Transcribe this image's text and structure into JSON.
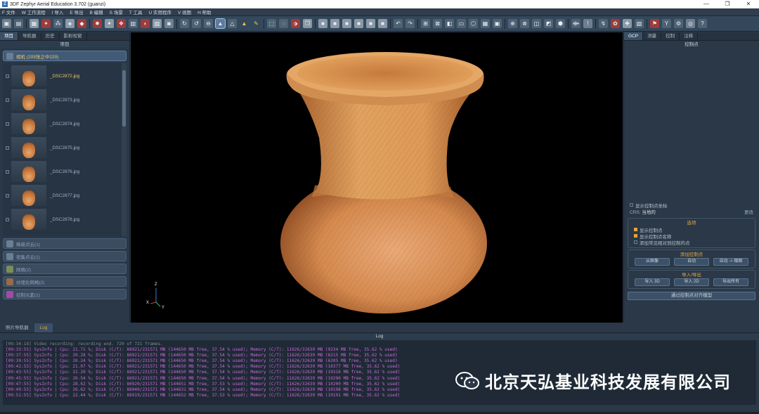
{
  "window": {
    "app_icon": "Z",
    "title": "3DF Zephyr Aerial Education 3.702 (guanzi)",
    "controls": [
      "—",
      "❐",
      "✕"
    ]
  },
  "menu": [
    "F 文件",
    "W 工作流程",
    "I 导入",
    "E 导出",
    "B 编辑",
    "S 场景",
    "T 工具",
    "U 实用程序",
    "V 视图",
    "H 帮助"
  ],
  "left_panel": {
    "tabs": [
      "项目",
      "导航器",
      "历史",
      "影射视窗"
    ],
    "header": "项目",
    "cameras_section": "相机 (209张之中229)",
    "thumbnails": [
      "_DSC2872.jpg",
      "_DSC2873.jpg",
      "_DSC2874.jpg",
      "_DSC2875.jpg",
      "_DSC2876.jpg",
      "_DSC2877.jpg",
      "_DSC2878.jpg"
    ],
    "sections": [
      "稀疏点云(1)",
      "密集点云(1)",
      "网格(2)",
      "纹理化网格(2)",
      "控制元素(1)"
    ]
  },
  "viewport": {
    "axis_labels": {
      "x": "X",
      "y": "Y",
      "z": "Z"
    }
  },
  "right_panel": {
    "tabs": [
      "GCP",
      "测量",
      "控制",
      "注释"
    ],
    "header": "控制点",
    "show_points_label": "显示控制点坐标",
    "crs_label": "CRS:",
    "crs_value": "当地的",
    "crs_button": "更改",
    "options_title": "选项",
    "options": [
      {
        "label": "显示控制点",
        "checked": true
      },
      {
        "label": "显示控制点名称",
        "checked": true
      },
      {
        "label": "添加常见相对到控制的点",
        "checked": false
      }
    ],
    "add_title": "添加控制点",
    "add_buttons": [
      "从图像",
      "自动",
      "自动 -> 缩图"
    ],
    "io_title": "导入/导出",
    "io_buttons": [
      "导入 3D",
      "导入 2D",
      "导出所有"
    ],
    "bottom_button": "通过控制点对齐模型"
  },
  "bottom_panel": {
    "tabs": [
      "照片导航器",
      "Log"
    ],
    "active_tab": "Log",
    "header": "Log",
    "lines": [
      "[09:34:18] Video recording: recording end. 720 of 721 frames.",
      "[09:33:55] SysInfo | Cpu: 21.71 %; Disk (C/T): 86921/231571 MB (144650 MB free, 37.54 % used); Memory (C/T): 11626/32639 MB (9234 MB free, 35.62 % used)",
      "[09:37:55] SysInfo | Cpu: 20.28 %; Disk (C/T): 86921/231571 MB (144650 MB free, 37.54 % used); Memory (C/T): 11626/32639 MB (6215 MB free, 35.62 % used)",
      "[09:39:55] SysInfo | Cpu: 20.24 %; Disk (C/T): 86921/231571 MB (144650 MB free, 37.54 % used); Memory (C/T): 11626/32639 MB (6205 MB free, 35.62 % used)",
      "[09:41:55] SysInfo | Cpu: 21.07 %; Disk (C/T): 86921/231571 MB (144650 MB free, 37.54 % used); Memory (C/T): 11626/32639 MB (10377 MB free, 35.62 % used)",
      "[09:43:55] SysInfo | Cpu: 22.20 %; Disk (C/T): 86921/231571 MB (144650 MB free, 37.54 % used); Memory (C/T): 11626/32639 MB (10316 MB free, 35.62 % used)",
      "[09:45:55] SysInfo | Cpu: 20.54 %; Disk (C/T): 86921/231571 MB (144650 MB free, 37.54 % used); Memory (C/T): 11626/32639 MB (10290 MB free, 35.62 % used)",
      "[09:47:55] SysInfo | Cpu: 28.62 %; Disk (C/T): 86920/231571 MB (144651 MB free, 37.53 % used); Memory (C/T): 11626/32639 MB (10200 MB free, 35.62 % used)",
      "[09:49:55] SysInfo | Cpu: 26.62 %; Disk (C/T): 86940/231571 MB (144631 MB free, 37.54 % used); Memory (C/T): 11626/32639 MB (10198 MB free, 35.62 % used)",
      "[09:51:55] SysInfo | Cpu: 22.44 %; Disk (C/T): 86919/231571 MB (144652 MB free, 37.53 % used); Memory (C/T): 11626/32639 MB (10191 MB free, 35.62 % used)"
    ],
    "watermark": "北京天弘基业科技发展有限公司"
  }
}
